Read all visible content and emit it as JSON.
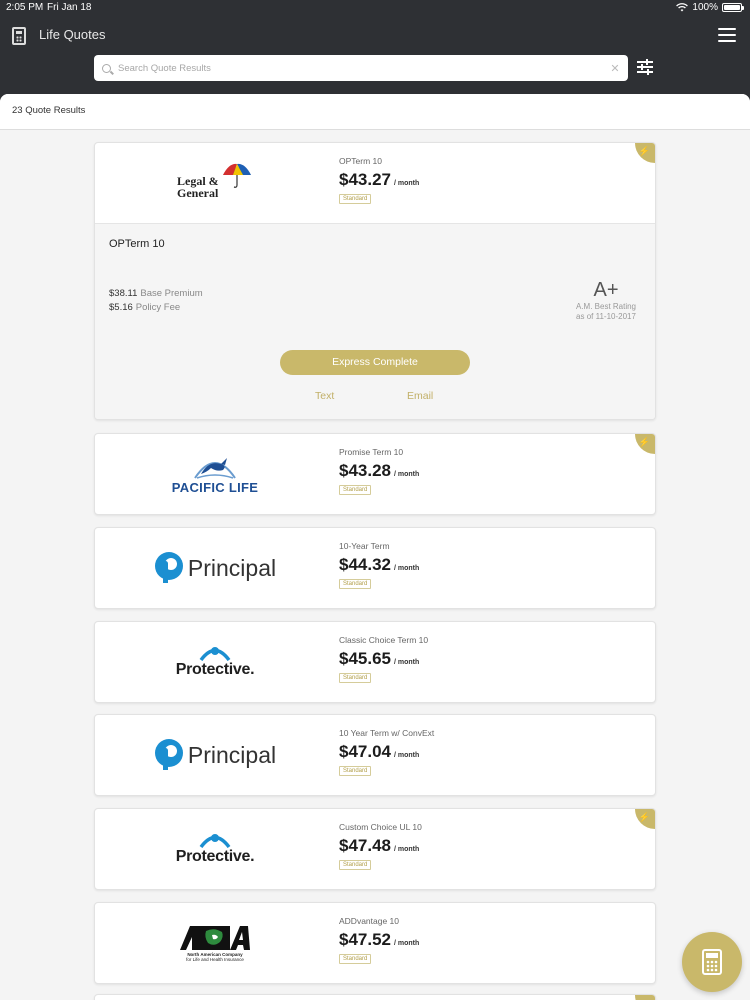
{
  "status": {
    "time": "2:05 PM",
    "date": "Fri Jan 18",
    "battery": "100%"
  },
  "header": {
    "title": "Life Quotes"
  },
  "search": {
    "placeholder": "Search Quote Results"
  },
  "results": {
    "count_label": "23 Quote Results"
  },
  "colors": {
    "accent": "#c9b86a",
    "header_bg": "#2e3034"
  },
  "quotes": [
    {
      "carrier": "Legal & General",
      "logo_text": [
        "Legal &",
        "General"
      ],
      "plan": "OPTerm 10",
      "price": "$43.27",
      "per": "/ month",
      "badge": "Standard",
      "flagged": true,
      "expanded": true,
      "detail": {
        "title": "OPTerm 10",
        "base_premium_amount": "$38.11",
        "base_premium_label": "Base Premium",
        "policy_fee_amount": "$5.16",
        "policy_fee_label": "Policy Fee",
        "rating": "A+",
        "rating_label": "A.M. Best Rating",
        "rating_date": "as of 11-10-2017",
        "express_label": "Express Complete",
        "text_label": "Text",
        "email_label": "Email"
      }
    },
    {
      "carrier": "Pacific Life",
      "logo_text": "PACIFIC LIFE",
      "plan": "Promise Term 10",
      "price": "$43.28",
      "per": "/ month",
      "badge": "Standard",
      "flagged": true
    },
    {
      "carrier": "Principal",
      "logo_text": "Principal",
      "plan": "10-Year Term",
      "price": "$44.32",
      "per": "/ month",
      "badge": "Standard",
      "flagged": false
    },
    {
      "carrier": "Protective",
      "logo_text": "Protective.",
      "plan": "Classic Choice Term 10",
      "price": "$45.65",
      "per": "/ month",
      "badge": "Standard",
      "flagged": false
    },
    {
      "carrier": "Principal",
      "logo_text": "Principal",
      "plan": "10 Year Term w/ ConvExt",
      "price": "$47.04",
      "per": "/ month",
      "badge": "Standard",
      "flagged": false
    },
    {
      "carrier": "Protective",
      "logo_text": "Protective.",
      "plan": "Custom Choice UL 10",
      "price": "$47.48",
      "per": "/ month",
      "badge": "Standard",
      "flagged": true
    },
    {
      "carrier": "North American Company",
      "logo_text": [
        "North American Company",
        "for Life and Health Insurance"
      ],
      "plan": "ADDvantage 10",
      "price": "$47.52",
      "per": "/ month",
      "badge": "Standard",
      "flagged": false
    }
  ]
}
